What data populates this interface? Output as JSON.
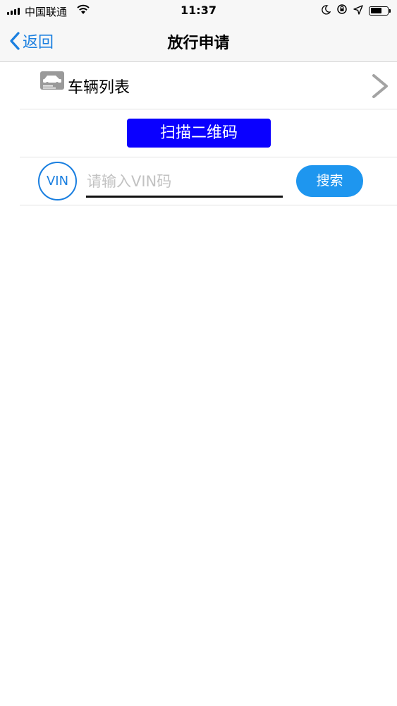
{
  "status_bar": {
    "carrier": "中国联通",
    "time": "11:37",
    "icons": [
      "signal-icon",
      "wifi-icon",
      "moon-icon",
      "orientation-lock-icon",
      "location-icon",
      "battery-icon"
    ]
  },
  "nav": {
    "back_label": "返回",
    "title": "放行申请"
  },
  "vehicle_list": {
    "label": "车辆列表",
    "icon": "car-card-icon"
  },
  "scan": {
    "button_label": "扫描二维码"
  },
  "vin_search": {
    "badge": "VIN",
    "placeholder": "请输入VIN码",
    "value": "",
    "button_label": "搜索"
  },
  "colors": {
    "accent": "#1a7fe0",
    "scan_button": "#0a00ff",
    "search_button": "#1e96ef"
  }
}
